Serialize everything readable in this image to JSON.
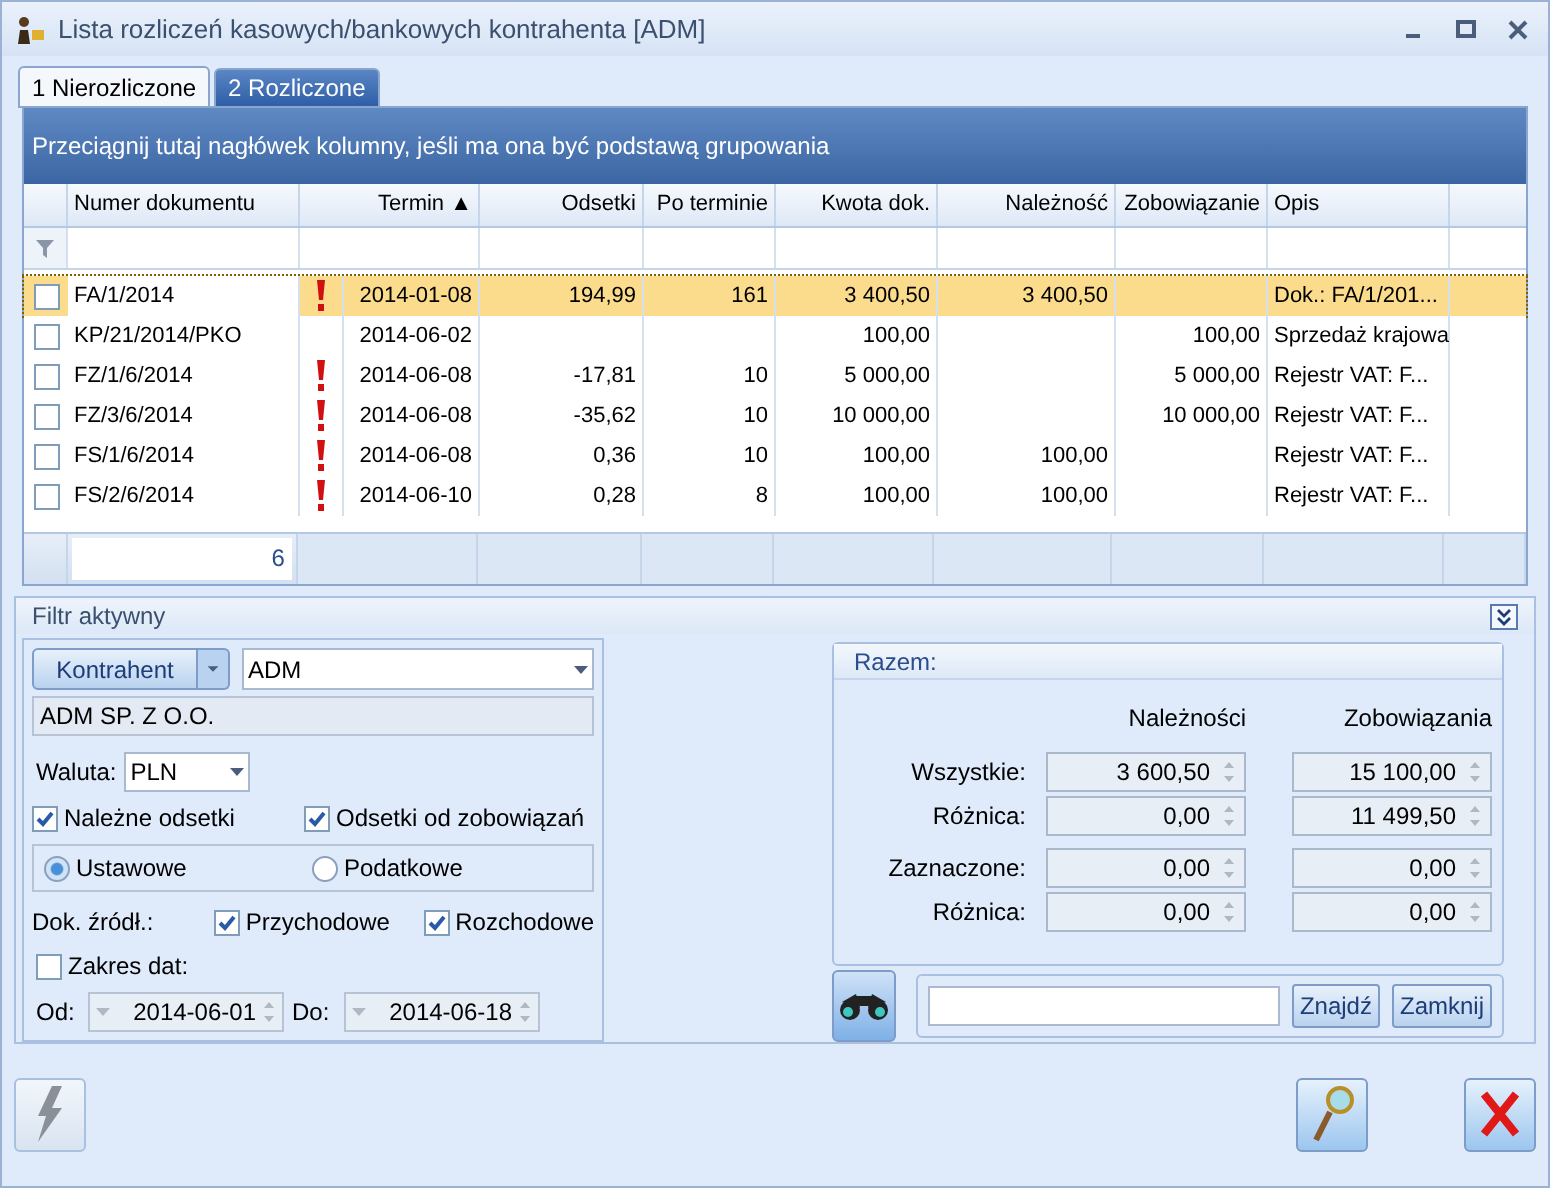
{
  "window": {
    "title": "Lista rozliczeń kasowych/bankowych kontrahenta [ADM]"
  },
  "tabs": [
    {
      "label": "1 Nierozliczone",
      "selected": true
    },
    {
      "label": "2 Rozliczone",
      "selected": false
    }
  ],
  "grid": {
    "group_hint": "Przeciągnij tutaj nagłówek kolumny, jeśli ma ona być podstawą grupowania",
    "columns": [
      "Numer dokumentu",
      "Termin ▲",
      "Odsetki",
      "Po terminie",
      "Kwota dok.",
      "Należność",
      "Zobowiązanie",
      "Opis"
    ],
    "rows": [
      {
        "selected": true,
        "checked": false,
        "overdue": true,
        "cells": [
          "FA/1/2014",
          "2014-01-08",
          "194,99",
          "161",
          "3 400,50",
          "3 400,50",
          "",
          "Dok.: FA/1/201..."
        ]
      },
      {
        "selected": false,
        "checked": false,
        "overdue": false,
        "cells": [
          "KP/21/2014/PKO",
          "2014-06-02",
          "",
          "",
          "100,00",
          "",
          "100,00",
          "Sprzedaż krajowa"
        ]
      },
      {
        "selected": false,
        "checked": false,
        "overdue": true,
        "cells": [
          "FZ/1/6/2014",
          "2014-06-08",
          "-17,81",
          "10",
          "5 000,00",
          "",
          "5 000,00",
          "Rejestr VAT: F..."
        ]
      },
      {
        "selected": false,
        "checked": false,
        "overdue": true,
        "cells": [
          "FZ/3/6/2014",
          "2014-06-08",
          "-35,62",
          "10",
          "10 000,00",
          "",
          "10 000,00",
          "Rejestr VAT: F..."
        ]
      },
      {
        "selected": false,
        "checked": false,
        "overdue": true,
        "cells": [
          "FS/1/6/2014",
          "2014-06-08",
          "0,36",
          "10",
          "100,00",
          "100,00",
          "",
          "Rejestr VAT: F..."
        ]
      },
      {
        "selected": false,
        "checked": false,
        "overdue": true,
        "cells": [
          "FS/2/6/2014",
          "2014-06-10",
          "0,28",
          "8",
          "100,00",
          "100,00",
          "",
          "Rejestr VAT: F..."
        ]
      }
    ],
    "count": "6"
  },
  "filter": {
    "title": "Filtr aktywny",
    "contractor_button": "Kontrahent",
    "contractor_value": "ADM",
    "contractor_name": "ADM SP. Z O.O.",
    "currency_label": "Waluta:",
    "currency_value": "PLN",
    "interest": [
      {
        "label": "Należne odsetki",
        "checked": true
      },
      {
        "label": "Odsetki od zobowiązań",
        "checked": true
      }
    ],
    "rates": [
      {
        "label": "Ustawowe",
        "selected": true
      },
      {
        "label": "Podatkowe",
        "selected": false
      }
    ],
    "source_label": "Dok. źródł.:",
    "sources": [
      {
        "label": "Przychodowe",
        "checked": true
      },
      {
        "label": "Rozchodowe",
        "checked": true
      }
    ],
    "date_range": {
      "label": "Zakres dat:",
      "checked": false
    },
    "from_label": "Od:",
    "from_value": "2014-06-01",
    "to_label": "Do:",
    "to_value": "2014-06-18"
  },
  "totals": {
    "title": "Razem:",
    "columns": [
      "Należności",
      "Zobowiązania"
    ],
    "rows": [
      {
        "label": "Wszystkie:",
        "values": [
          "3 600,50",
          "15 100,00"
        ]
      },
      {
        "label": "Różnica:",
        "values": [
          "0,00",
          "11 499,50"
        ]
      },
      {
        "label": "Zaznaczone:",
        "values": [
          "0,00",
          "0,00"
        ]
      },
      {
        "label": "Różnica:",
        "values": [
          "0,00",
          "0,00"
        ]
      }
    ]
  },
  "search": {
    "find_button": "Znajdź",
    "close_button": "Zamknij"
  }
}
